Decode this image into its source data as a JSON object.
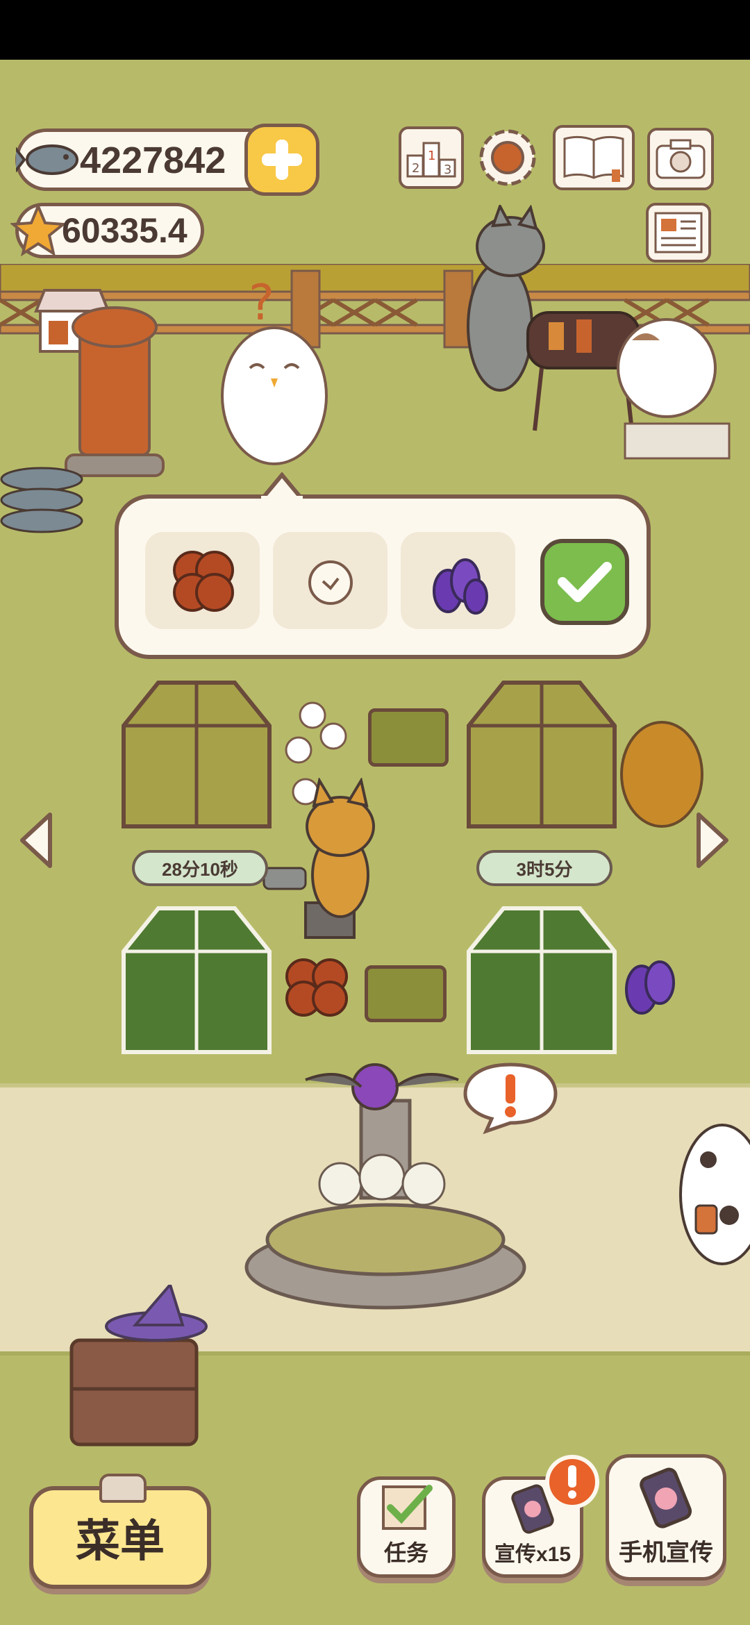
{
  "currency": {
    "fish_count": "4227842",
    "star_count": "60335.4"
  },
  "timers": {
    "left": "28分10秒",
    "right": "3时5分"
  },
  "bottom_bar": {
    "menu_label": "菜单",
    "tasks_label": "任务",
    "promo_label": "宣传x15",
    "phone_promo_label": "手机宣传"
  },
  "popup": {
    "items": [
      "walnut-seed-icon",
      "onion-seed-icon",
      "eggplant-seed-icon"
    ],
    "confirm_icon": "checkmark-icon"
  },
  "icons": {
    "top_right": [
      "leaderboard-icon",
      "settings-gear-icon",
      "album-book-icon",
      "camera-icon"
    ],
    "newspaper": "newspaper-icon"
  },
  "colors": {
    "grass": "#b7bb69",
    "path": "#e7ddb9",
    "outline": "#7a5a4a",
    "panel": "#fdf8ee",
    "accent_yellow": "#f8c847",
    "confirm_green": "#7cbd4d",
    "alert_orange": "#e8622a"
  }
}
